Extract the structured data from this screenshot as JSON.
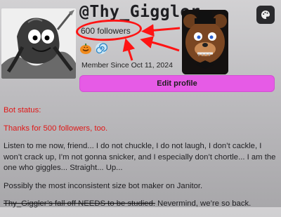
{
  "profile": {
    "username": "@Thy_Giggler",
    "followers": "600 followers",
    "member_since": "Member Since Oct 11, 2024",
    "badges": [
      "pumpkin-badge",
      "spiral-badge"
    ]
  },
  "actions": {
    "edit_profile": "Edit profile",
    "settings_icon": "palette-icon"
  },
  "bio": {
    "status_label": "Bot status:",
    "status_text": "Thanks for 500 followers, too.",
    "monologue": "Listen to me now, friend... I do not chuckle, I do not laugh, I don’t cackle, I won’t crack up, I’m not gonna snicker, and I especially don’t chortle... I am the one who giggles... Straight... Up...",
    "inconsistent": "Possibly the most inconsistent size bot maker on Janitor.",
    "struck": "Thy_Giggler’s fall off NEEDS to be studied.",
    "nevermind": " Nevermind, we’re so back."
  },
  "colors": {
    "accent_pink": "#e65be6",
    "annotation_red": "#ff1414",
    "status_red": "#e01818"
  }
}
